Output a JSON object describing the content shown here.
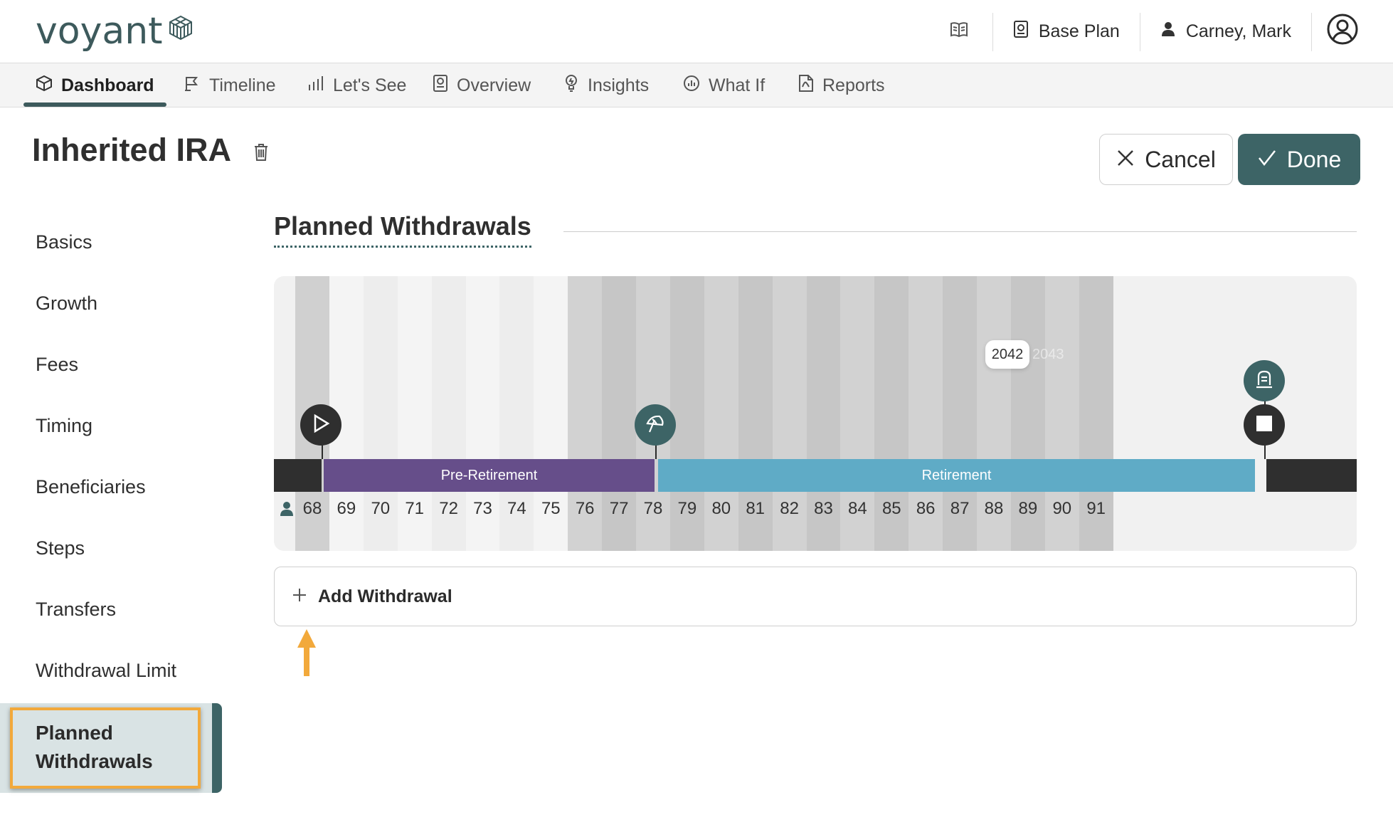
{
  "header": {
    "logo_text": "voyant",
    "plan_label": "Base Plan",
    "user_name": "Carney, Mark"
  },
  "nav": {
    "tabs": [
      {
        "label": "Dashboard",
        "active": true
      },
      {
        "label": "Timeline"
      },
      {
        "label": "Let's See"
      },
      {
        "label": "Overview"
      },
      {
        "label": "Insights"
      },
      {
        "label": "What If"
      },
      {
        "label": "Reports"
      }
    ]
  },
  "page": {
    "title": "Inherited IRA",
    "cancel_label": "Cancel",
    "done_label": "Done"
  },
  "sidebar": {
    "items": [
      {
        "label": "Basics"
      },
      {
        "label": "Growth"
      },
      {
        "label": "Fees"
      },
      {
        "label": "Timing"
      },
      {
        "label": "Beneficiaries"
      },
      {
        "label": "Steps"
      },
      {
        "label": "Transfers"
      },
      {
        "label": "Withdrawal Limit"
      },
      {
        "label": "Planned Withdrawals",
        "active": true
      }
    ]
  },
  "section": {
    "title": "Planned Withdrawals",
    "add_label": "Add Withdrawal"
  },
  "timeline": {
    "ages": [
      "68",
      "69",
      "70",
      "71",
      "72",
      "73",
      "74",
      "75",
      "76",
      "77",
      "78",
      "79",
      "80",
      "81",
      "82",
      "83",
      "84",
      "85",
      "86",
      "87",
      "88",
      "89",
      "90",
      "91"
    ],
    "phases": [
      {
        "label": "Pre-Retirement",
        "color": "#664e8a"
      },
      {
        "label": "Retirement",
        "color": "#5fabc6"
      }
    ],
    "year_tooltip": "2042",
    "year_ghost": "2043",
    "markers": [
      "play-icon",
      "beach-umbrella-icon",
      "tombstone-icon",
      "stop-icon"
    ]
  },
  "colors": {
    "accent": "#3d6466",
    "highlight": "#f2a93b",
    "pre_retirement": "#664e8a",
    "retirement": "#5fabc6"
  }
}
